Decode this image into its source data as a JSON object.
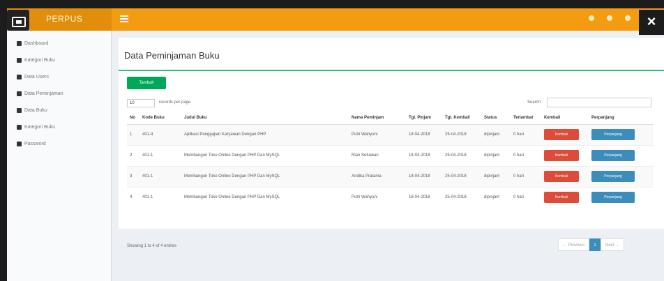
{
  "header": {
    "logo_text": "PERPUS",
    "close_label": "×"
  },
  "sidebar": {
    "items": [
      {
        "label": "Dashboard",
        "icon": "dashboard-icon"
      },
      {
        "label": "Kategori Buku",
        "icon": "book-icon"
      },
      {
        "label": "Data Users",
        "icon": "user-icon"
      },
      {
        "label": "Data Peminjaman",
        "icon": "users-icon"
      },
      {
        "label": "Data Buku",
        "icon": "book-icon"
      },
      {
        "label": "Kategori Buku",
        "icon": "book-icon"
      },
      {
        "label": "Password",
        "icon": "user-icon"
      }
    ]
  },
  "main": {
    "title": "Data Peminjaman Buku",
    "add_button": "Tambah",
    "length_value": "10",
    "length_label": "records per page",
    "search_label": "Search:",
    "columns": [
      "No",
      "Kode Buku",
      "Judul Buku",
      "Nama Peminjam",
      "Tgl. Pinjam",
      "Tgl. Kembali",
      "Status",
      "Terlambat",
      "Kembali",
      "Perpanjang"
    ],
    "rows": [
      {
        "no": "1",
        "kode": "401-4",
        "judul": "Aplikasi Penggajian Karyawan Dengan PHP",
        "nama": "Putri Wahyuni",
        "tgl_pinjam": "18-04-2018",
        "tgl_kembali": "25-04-2018",
        "status": "dipinjam",
        "terlambat": "0 hari",
        "kembali": "Kembali",
        "perpanjang": "Perpanjang"
      },
      {
        "no": "2",
        "kode": "401-1",
        "judul": "Membangun Toko Online Dengan PHP Dan MySQL",
        "nama": "Rian Setiawan",
        "tgl_pinjam": "18-04-2018",
        "tgl_kembali": "25-04-2018",
        "status": "dipinjam",
        "terlambat": "0 hari",
        "kembali": "Kembali",
        "perpanjang": "Perpanjang"
      },
      {
        "no": "3",
        "kode": "401-1",
        "judul": "Membangun Toko Online Dengan PHP Dan MySQL",
        "nama": "Andika Pratama",
        "tgl_pinjam": "18-04-2018",
        "tgl_kembali": "25-04-2018",
        "status": "dipinjam",
        "terlambat": "0 hari",
        "kembali": "Kembali",
        "perpanjang": "Perpanjang"
      },
      {
        "no": "4",
        "kode": "401-1",
        "judul": "Membangun Toko Online Dengan PHP Dan MySQL",
        "nama": "Putri Wahyuni",
        "tgl_pinjam": "18-04-2018",
        "tgl_kembali": "25-04-2018",
        "status": "dipinjam",
        "terlambat": "0 hari",
        "kembali": "Kembali",
        "perpanjang": "Perpanjang"
      }
    ],
    "info": "Showing 1 to 4 of 4 entries",
    "pager": {
      "prev": "← Previous",
      "page": "1",
      "next": "Next →"
    }
  },
  "colors": {
    "topbar": "#f39c12",
    "green": "#00a65a",
    "red": "#dd4b39",
    "blue": "#3c8dbc"
  }
}
